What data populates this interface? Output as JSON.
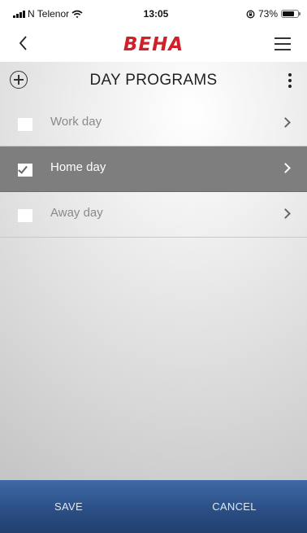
{
  "status_bar": {
    "carrier": "N Telenor",
    "time": "13:05",
    "battery_percent": "73%",
    "icons": [
      "signal-icon",
      "wifi-icon",
      "orientation-lock-icon",
      "battery-icon"
    ]
  },
  "nav": {
    "logo": "BEHA",
    "back_icon": "back-chevron-icon",
    "menu_icon": "hamburger-menu-icon"
  },
  "header": {
    "title": "DAY PROGRAMS",
    "add_icon": "add-circle-icon",
    "more_icon": "more-vertical-icon"
  },
  "programs": [
    {
      "label": "Work day",
      "checked": false,
      "selected": false
    },
    {
      "label": "Home day",
      "checked": true,
      "selected": true
    },
    {
      "label": "Away day",
      "checked": false,
      "selected": false
    }
  ],
  "footer": {
    "save_label": "SAVE",
    "cancel_label": "CANCEL"
  },
  "colors": {
    "brand_red": "#d0202a",
    "selected_row": "#7e7e7e",
    "footer_blue": "#2b4f86"
  }
}
